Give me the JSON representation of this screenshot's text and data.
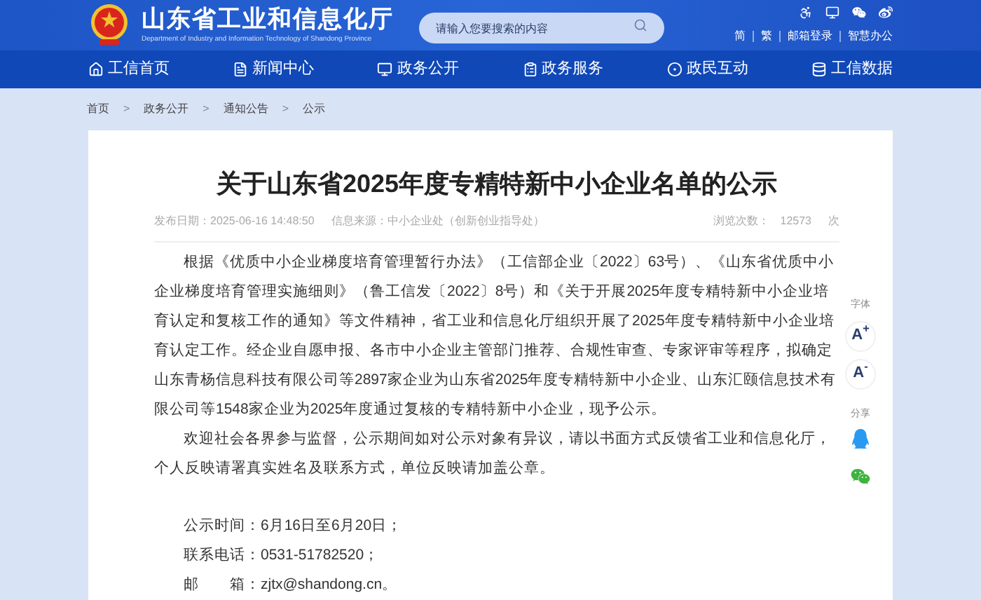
{
  "header": {
    "site_title": "山东省工业和信息化厅",
    "site_subtitle": "Department of Industry and Information Technology of Shandong Province",
    "search": {
      "placeholder": "请输入您要搜索的内容"
    },
    "top_links": [
      "简",
      "繁",
      "邮箱登录",
      "智慧办公"
    ]
  },
  "nav": {
    "items": [
      {
        "label": "工信首页"
      },
      {
        "label": "新闻中心"
      },
      {
        "label": "政务公开"
      },
      {
        "label": "政务服务"
      },
      {
        "label": "政民互动"
      },
      {
        "label": "工信数据"
      }
    ]
  },
  "breadcrumb": [
    {
      "kind": "link",
      "text": "首页"
    },
    {
      "kind": "separator",
      "text": ">"
    },
    {
      "kind": "link",
      "text": "政务公开"
    },
    {
      "kind": "separator",
      "text": ">"
    },
    {
      "kind": "link",
      "text": "通知公告"
    },
    {
      "kind": "separator",
      "text": ">"
    },
    {
      "kind": "link",
      "text": "公示"
    }
  ],
  "article": {
    "title": "关于山东省2025年度专精特新中小企业名单的公示",
    "meta": {
      "date_label": "发布日期：",
      "date": "2025-06-16 14:48:50",
      "source_label": "信息来源：",
      "source": "中小企业处（创新创业指导处）",
      "views_label": "浏览次数：",
      "views": "12573",
      "views_unit": "次"
    },
    "paragraphs": [
      "根据《优质中小企业梯度培育管理暂行办法》（工信部企业〔2022〕63号）、《山东省优质中小企业梯度培育管理实施细则》（鲁工信发〔2022〕8号）和《关于开展2025年度专精特新中小企业培育认定和复核工作的通知》等文件精神，省工业和信息化厅组织开展了2025年度专精特新中小企业培育认定工作。经企业自愿申报、各市中小企业主管部门推荐、合规性审查、专家评审等程序，拟确定山东青杨信息科技有限公司等2897家企业为山东省2025年度专精特新中小企业、山东汇颐信息技术有限公司等1548家企业为2025年度通过复核的专精特新中小企业，现予公示。",
      "欢迎社会各界参与监督，公示期间如对公示对象有异议，请以书面方式反馈省工业和信息化厅，个人反映请署真实姓名及联系方式，单位反映请加盖公章。"
    ],
    "contacts": [
      "公示时间：6月16日至6月20日；",
      "联系电话：0531-51782520；",
      "邮　　箱：zjtx@shandong.cn。"
    ]
  },
  "tools": {
    "font_label": "字体",
    "font_buttons": [
      "A$^{+}$",
      "A$^{-}$"
    ],
    "share_label": "分享"
  }
}
